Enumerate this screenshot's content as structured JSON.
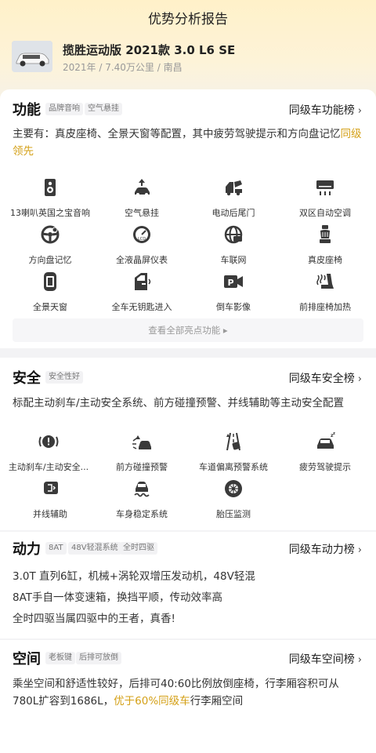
{
  "header": {
    "title": "优势分析报告",
    "car_name": "揽胜运动版 2021款 3.0 L6 SE",
    "car_meta": "2021年 / 7.40万公里 / 南昌"
  },
  "function": {
    "title": "功能",
    "tags": [
      "品牌音响",
      "空气悬挂"
    ],
    "rank_label": "同级车功能榜",
    "desc_main": "主要有：真皮座椅、全景天窗等配置，其中疲劳驾驶提示和方向盘记忆",
    "desc_hl": "同级领先",
    "items": [
      {
        "label": "13喇叭英国之宝音响",
        "icon": "speaker-icon"
      },
      {
        "label": "空气悬挂",
        "icon": "air-suspension-icon"
      },
      {
        "label": "电动后尾门",
        "icon": "power-tailgate-icon"
      },
      {
        "label": "双区自动空调",
        "icon": "air-conditioner-icon"
      },
      {
        "label": "方向盘记忆",
        "icon": "steering-wheel-icon"
      },
      {
        "label": "全液晶屏仪表",
        "icon": "lcd-dashboard-icon"
      },
      {
        "label": "车联网",
        "icon": "connected-car-icon"
      },
      {
        "label": "真皮座椅",
        "icon": "leather-seat-icon"
      },
      {
        "label": "全景天窗",
        "icon": "panoramic-sunroof-icon"
      },
      {
        "label": "全车无钥匙进入",
        "icon": "keyless-entry-icon"
      },
      {
        "label": "倒车影像",
        "icon": "reverse-camera-icon"
      },
      {
        "label": "前排座椅加热",
        "icon": "seat-heating-icon"
      }
    ],
    "more_label": "查看全部亮点功能 ▸"
  },
  "safety": {
    "title": "安全",
    "tags": [
      "安全性好"
    ],
    "rank_label": "同级车安全榜",
    "desc": "标配主动刹车/主动安全系统、前方碰撞预警、并线辅助等主动安全配置",
    "items": [
      {
        "label": "主动刹车/主动安全...",
        "icon": "active-brake-icon"
      },
      {
        "label": "前方碰撞预警",
        "icon": "collision-warning-icon"
      },
      {
        "label": "车道偏离预警系统",
        "icon": "lane-departure-icon"
      },
      {
        "label": "疲劳驾驶提示",
        "icon": "fatigue-driving-icon"
      },
      {
        "label": "并线辅助",
        "icon": "blind-spot-icon"
      },
      {
        "label": "车身稳定系统",
        "icon": "stability-control-icon"
      },
      {
        "label": "胎压监测",
        "icon": "tire-pressure-icon"
      }
    ]
  },
  "power": {
    "title": "动力",
    "tags": [
      "8AT",
      "48V轻混系统",
      "全时四驱"
    ],
    "rank_label": "同级车动力榜",
    "lines": [
      "3.0T 直列6缸，机械+涡轮双增压发动机，48V轻混",
      "8AT手自一体变速箱，换挡平顺，传动效率高",
      "全时四驱当属四驱中的王者，真香!"
    ]
  },
  "space": {
    "title": "空间",
    "tags": [
      "老板键",
      "后排可放倒"
    ],
    "rank_label": "同级车空间榜",
    "desc_main": "乘坐空间和舒适性较好，后排可40:60比例放倒座椅，行李厢容积可从780L扩容到1686L，",
    "desc_hl": "优于60%同级车",
    "desc_tail": "行李厢空间"
  },
  "colors": {
    "accent": "#d4a017",
    "icon": "#3a3a3a"
  }
}
